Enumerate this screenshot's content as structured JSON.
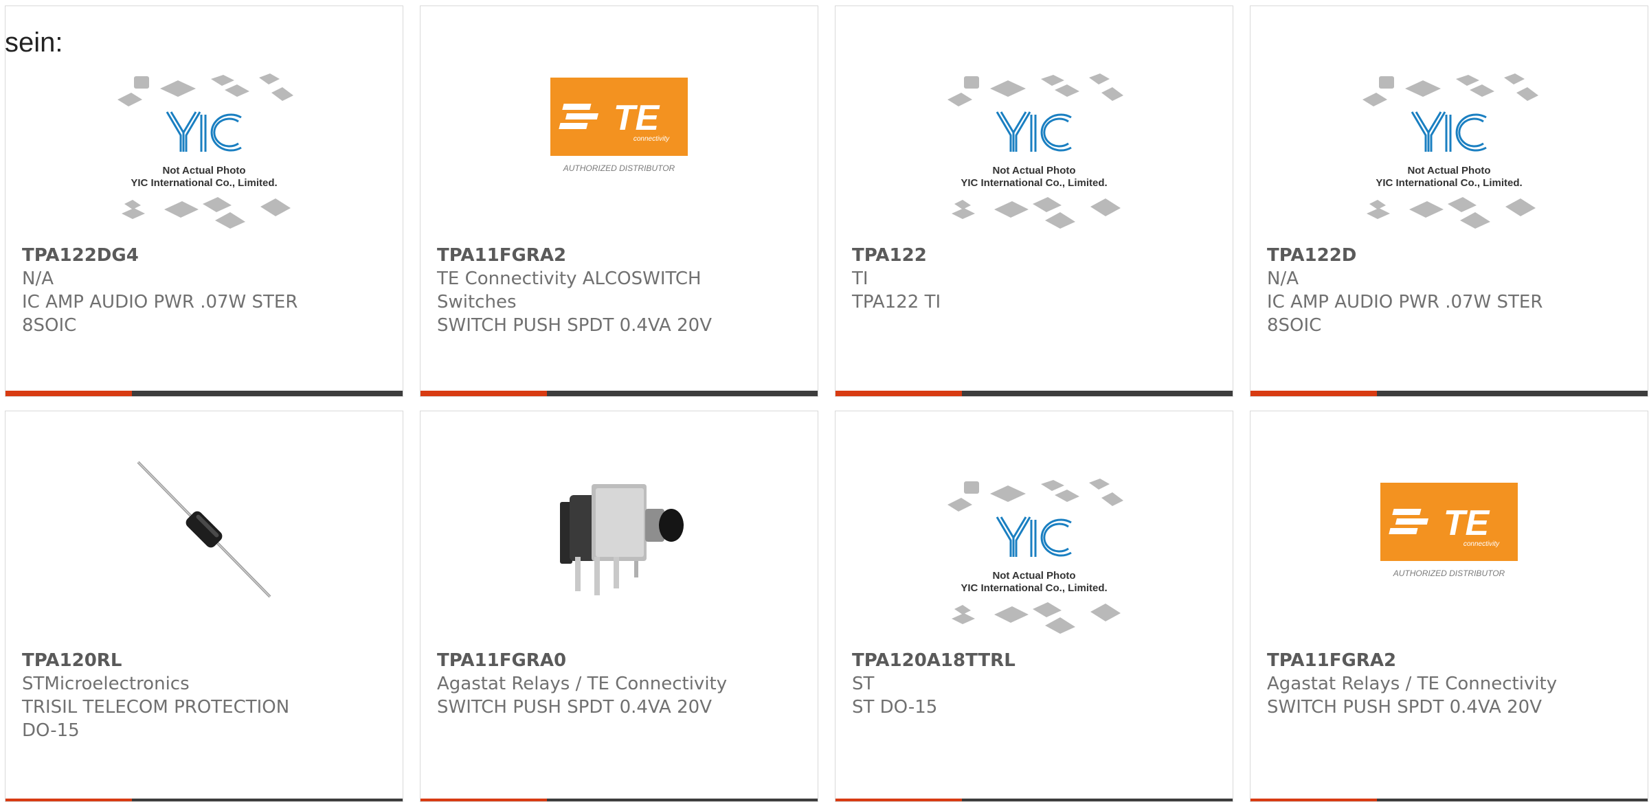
{
  "intro_text": "sein:",
  "colors": {
    "accent": "#d83b12",
    "bar": "#3d3d3d",
    "te_orange": "#f39220",
    "yic_blue": "#1a7fc1"
  },
  "placeholder_image": {
    "line1": "Not Actual Photo",
    "line2": "YIC International Co., Limited.",
    "logo_text": "YIC"
  },
  "te_image": {
    "logo_text": "TE",
    "sub_text": "connectivity",
    "caption": "AUTHORIZED DISTRIBUTOR"
  },
  "products": [
    {
      "part": "TPA122DG4",
      "image": "yic-placeholder",
      "lines": [
        "N/A",
        "IC AMP AUDIO PWR .07W STER",
        "8SOIC"
      ]
    },
    {
      "part": "TPA11FGRA2",
      "image": "te-logo",
      "lines": [
        "TE Connectivity ALCOSWITCH",
        "Switches",
        "SWITCH PUSH SPDT 0.4VA 20V"
      ]
    },
    {
      "part": "TPA122",
      "image": "yic-placeholder",
      "lines": [
        "TI",
        "TPA122 TI"
      ]
    },
    {
      "part": "TPA122D",
      "image": "yic-placeholder",
      "lines": [
        "N/A",
        "IC AMP AUDIO PWR .07W STER",
        "8SOIC"
      ]
    },
    {
      "part": "TPA120RL",
      "image": "diode-photo",
      "lines": [
        "STMicroelectronics",
        "TRISIL TELECOM PROTECTION",
        "DO-15"
      ]
    },
    {
      "part": "TPA11FGRA0",
      "image": "switch-photo",
      "lines": [
        "Agastat Relays / TE Connectivity",
        "SWITCH PUSH SPDT 0.4VA 20V"
      ]
    },
    {
      "part": "TPA120A18TTRL",
      "image": "yic-placeholder",
      "lines": [
        "ST",
        "ST DO-15"
      ]
    },
    {
      "part": "TPA11FGRA2",
      "image": "te-logo",
      "lines": [
        "Agastat Relays / TE Connectivity",
        "SWITCH PUSH SPDT 0.4VA 20V"
      ]
    }
  ]
}
